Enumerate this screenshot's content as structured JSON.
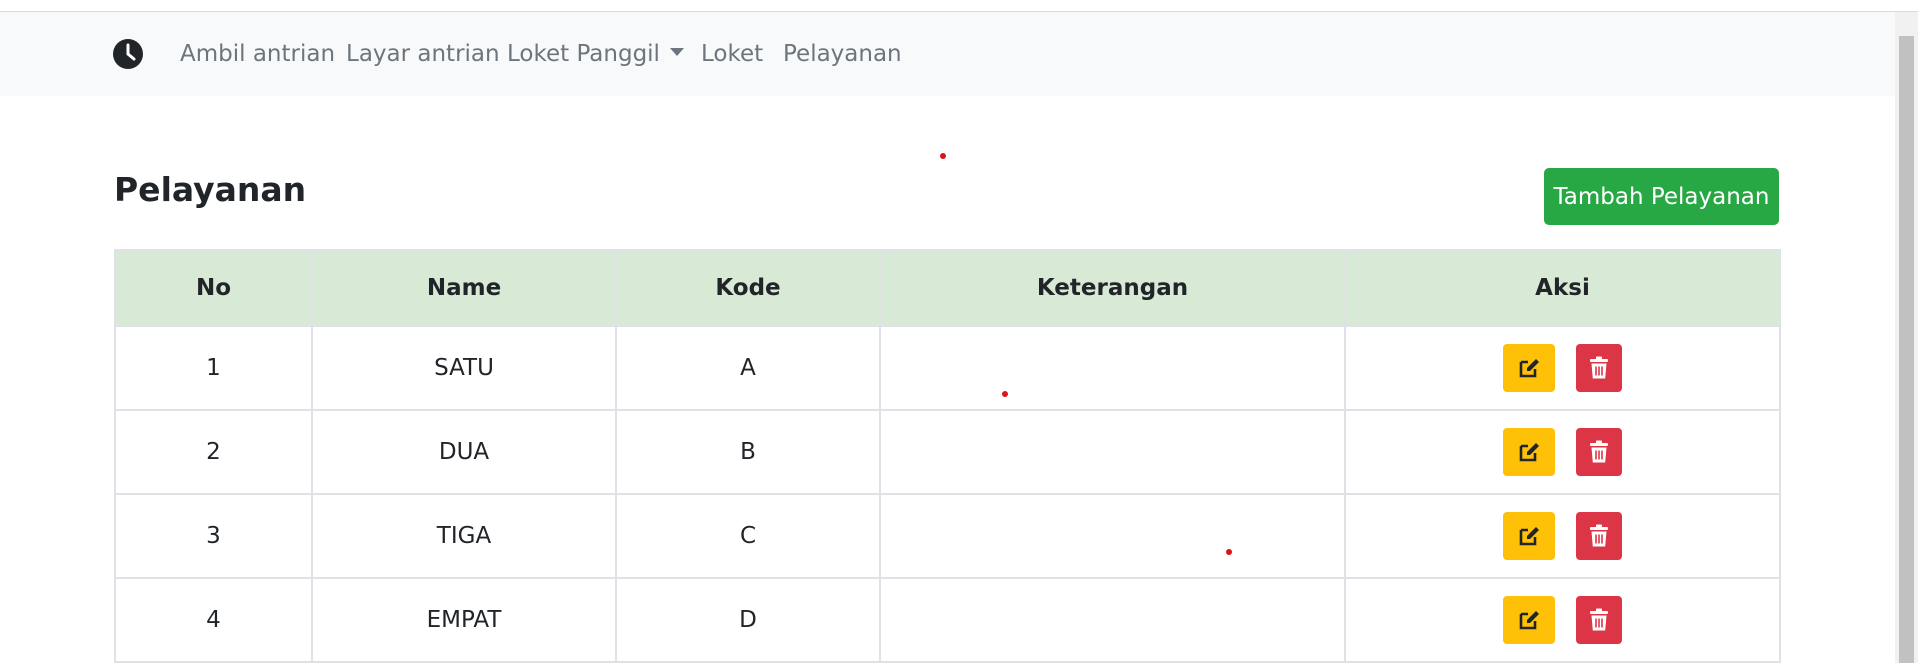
{
  "nav": {
    "brand_icon": "clock-icon",
    "links": [
      "Ambil antrian",
      "Layar antrian",
      "Loket Panggil",
      "Loket",
      "Pelayanan"
    ]
  },
  "page": {
    "title": "Pelayanan",
    "add_button": "Tambah Pelayanan"
  },
  "table": {
    "headers": [
      "No",
      "Name",
      "Kode",
      "Keterangan",
      "Aksi"
    ],
    "rows": [
      {
        "no": "1",
        "name": "SATU",
        "kode": "A",
        "keterangan": ""
      },
      {
        "no": "2",
        "name": "DUA",
        "kode": "B",
        "keterangan": ""
      },
      {
        "no": "3",
        "name": "TIGA",
        "kode": "C",
        "keterangan": ""
      },
      {
        "no": "4",
        "name": "EMPAT",
        "kode": "D",
        "keterangan": ""
      }
    ],
    "action_icons": [
      "edit-icon",
      "trash-icon"
    ]
  },
  "colors": {
    "navbar_bg": "#f8f9fa",
    "header_bg": "#d8e9d5",
    "success": "#28a745",
    "warning": "#ffc107",
    "danger": "#dc3545"
  }
}
